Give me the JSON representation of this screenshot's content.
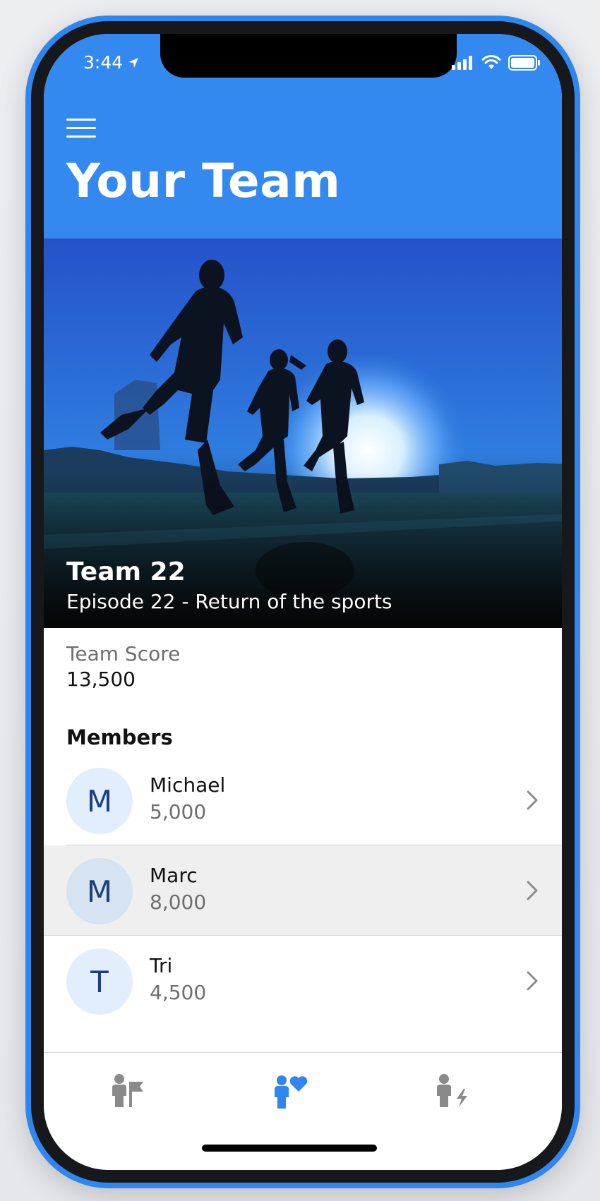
{
  "status_bar": {
    "time": "3:44",
    "location_icon": "location-arrow-icon",
    "signal_icon": "cellular-signal-icon",
    "wifi_icon": "wifi-icon",
    "battery_icon": "battery-icon"
  },
  "header": {
    "menu_icon": "hamburger-menu-icon",
    "title": "Your Team",
    "background_color": "#3389ef"
  },
  "hero": {
    "team_name": "Team 22",
    "subtitle": "Episode 22 - Return of the sports"
  },
  "score": {
    "label": "Team Score",
    "value": "13,500"
  },
  "members": {
    "heading": "Members",
    "items": [
      {
        "initial": "M",
        "name": "Michael",
        "score": "5,000",
        "selected": false
      },
      {
        "initial": "M",
        "name": "Marc",
        "score": "8,000",
        "selected": true
      },
      {
        "initial": "T",
        "name": "Tri",
        "score": "4,500",
        "selected": false
      }
    ]
  },
  "tabbar": {
    "tabs": [
      {
        "icon": "person-flag-icon",
        "active": false
      },
      {
        "icon": "person-heart-icon",
        "active": true
      },
      {
        "icon": "person-bolt-icon",
        "active": false
      }
    ],
    "active_color": "#2f86ee",
    "inactive_color": "#8a8a8a"
  }
}
